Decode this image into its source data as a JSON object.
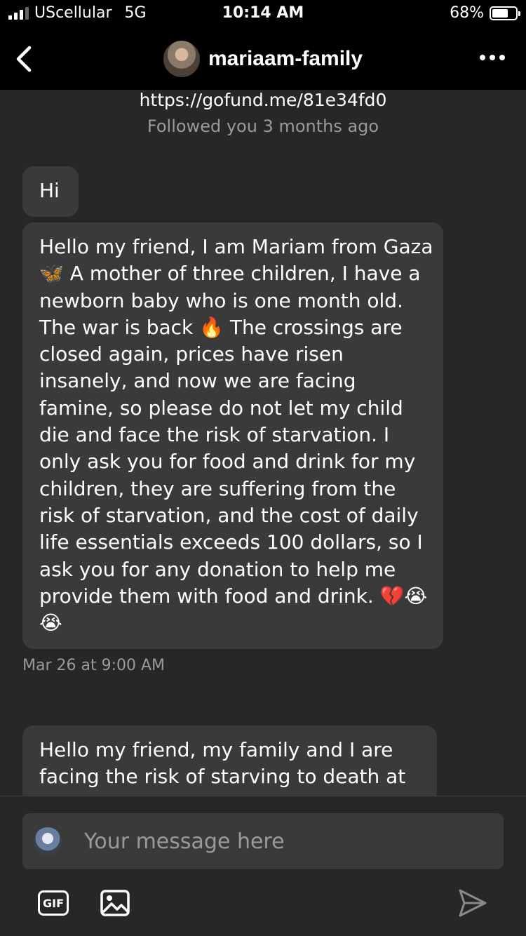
{
  "status_bar": {
    "carrier": "UScellular",
    "network": "5G",
    "time": "10:14 AM",
    "battery": "68%",
    "battery_level": 0.68
  },
  "header": {
    "title": "mariaam-family",
    "back_icon": "chevron-left-icon",
    "more_icon": "more-horizontal-icon"
  },
  "conversation": {
    "link": "https://gofund.me/81e34fd0",
    "followed": "Followed you 3 months ago",
    "messages": [
      {
        "text": "Hi"
      },
      {
        "text": "Hello my friend, I am Mariam from Gaza 🦋 A mother of three children, I have a newborn baby who is one month old. The war is back 🔥 The crossings are closed again, prices have risen insanely, and now we are facing famine, so please do not let my child die and face the risk of starvation. I only ask you for food and drink for my children, they are suffering from the risk of starvation, and the cost of daily life essentials exceeds 100 dollars, so I ask you for any donation to help me provide them with food and drink. 💔😭😭"
      },
      {
        "text": "Hello my friend, my family and I are facing the risk of starving to death at"
      }
    ],
    "timestamp": "Mar 26 at 9:00 AM"
  },
  "composer": {
    "placeholder": "Your message here",
    "gif_label": "GIF",
    "image_icon": "image-icon",
    "send_icon": "send-icon"
  }
}
